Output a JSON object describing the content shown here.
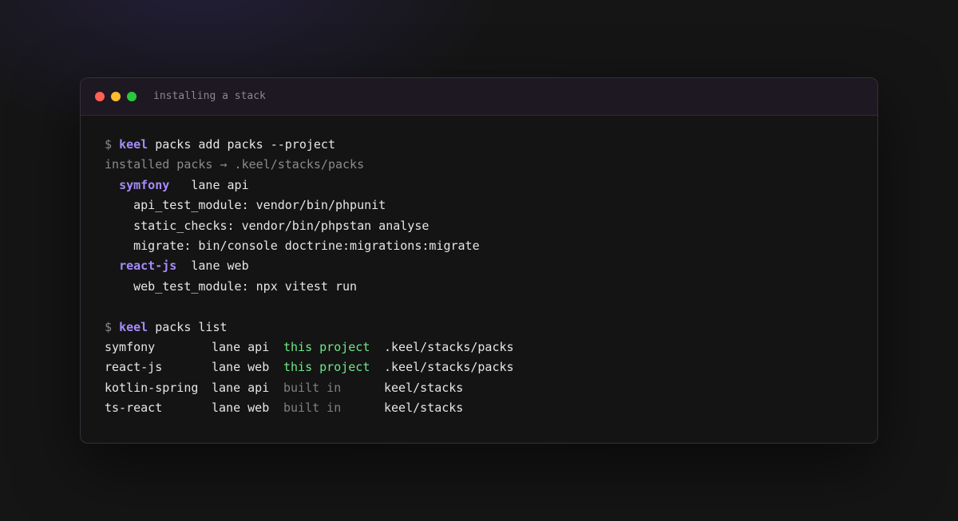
{
  "window": {
    "title": "installing a stack"
  },
  "terminal": {
    "add_command": {
      "prompt": "$",
      "binary": "keel",
      "args": "packs add packs --project"
    },
    "installed_line": "installed packs → .keel/stacks/packs",
    "installed_packs": [
      {
        "name": "symfony",
        "gap": "   ",
        "lane": "lane api",
        "modules": [
          "api_test_module: vendor/bin/phpunit",
          "static_checks: vendor/bin/phpstan analyse",
          "migrate: bin/console doctrine:migrations:migrate"
        ]
      },
      {
        "name": "react-js",
        "gap": "  ",
        "lane": "lane web",
        "modules": [
          "web_test_module: npx vitest run"
        ]
      }
    ],
    "list_command": {
      "prompt": "$",
      "binary": "keel",
      "args": "packs list"
    },
    "pack_list": [
      {
        "name": "symfony",
        "lane": "lane api",
        "origin": "this project",
        "origin_kind": "project",
        "path": ".keel/stacks/packs"
      },
      {
        "name": "react-js",
        "lane": "lane web",
        "origin": "this project",
        "origin_kind": "project",
        "path": ".keel/stacks/packs"
      },
      {
        "name": "kotlin-spring",
        "lane": "lane api",
        "origin": "built in",
        "origin_kind": "builtin",
        "path": "keel/stacks"
      },
      {
        "name": "ts-react",
        "lane": "lane web",
        "origin": "built in",
        "origin_kind": "builtin",
        "path": "keel/stacks"
      }
    ]
  },
  "colors": {
    "accent_purple": "#a78bfa",
    "project_green": "#6ee787",
    "muted_gray": "#808080",
    "close_red": "#ff5f57",
    "minimize_yellow": "#febc2e",
    "maximize_green": "#28c840"
  }
}
